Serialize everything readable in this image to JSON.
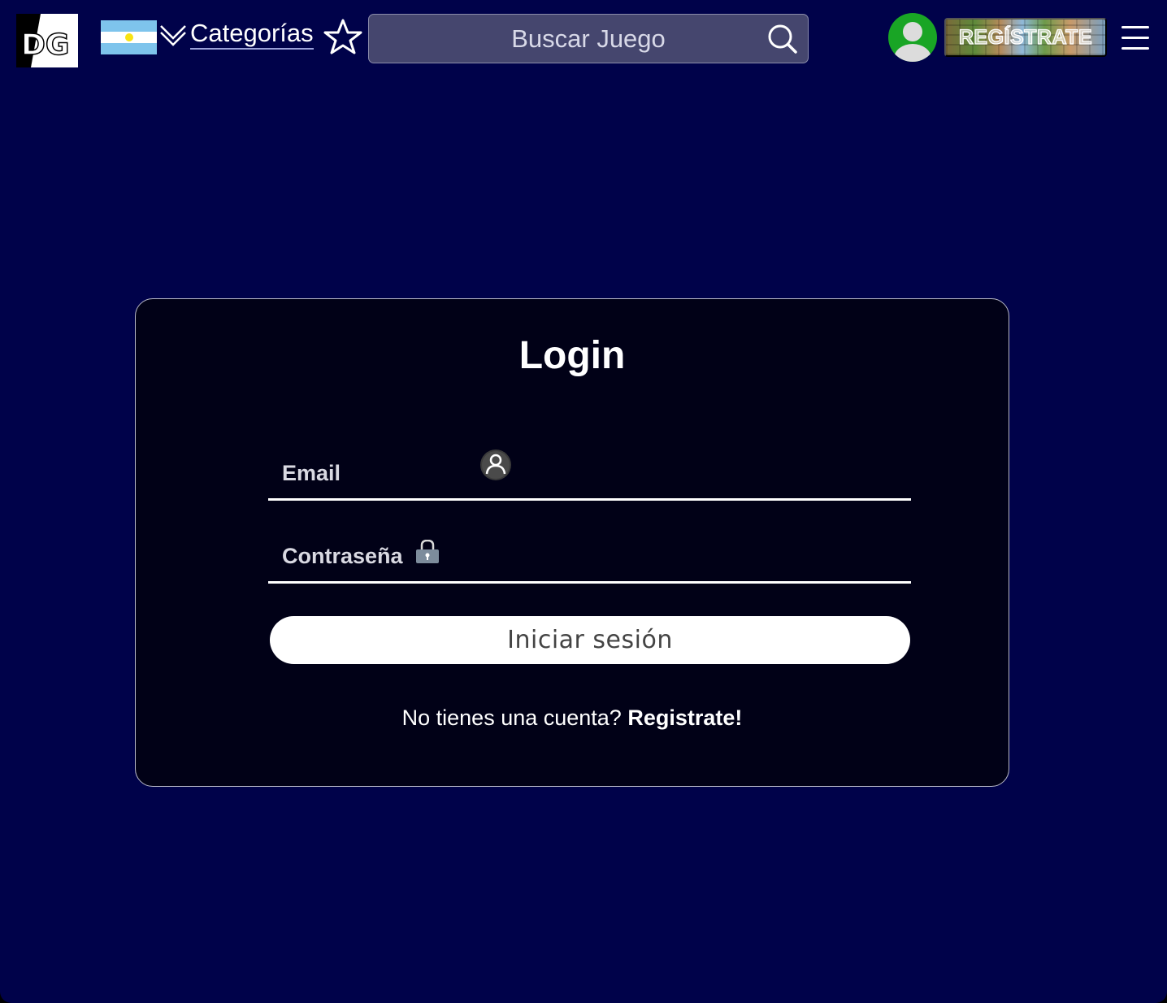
{
  "header": {
    "logo_text": "DG",
    "categories_label": "Categorías",
    "search": {
      "placeholder": "Buscar Juego"
    },
    "register_label": "REGÍSTRATE",
    "icons": {
      "flag": "argentina-flag-icon",
      "chevron": "chevron-down-icon",
      "favorites": "star-icon",
      "search": "search-icon",
      "avatar": "user-avatar-icon",
      "menu": "hamburger-menu-icon"
    }
  },
  "login": {
    "title": "Login",
    "email_label": "Email",
    "password_label": "Contraseña",
    "submit_label": "Iniciar sesión",
    "no_account_text": "No tienes una cuenta? ",
    "register_link": "Registrate!",
    "icons": {
      "email": "user-circle-icon",
      "password": "lock-icon"
    }
  },
  "colors": {
    "page_background": "#00024a",
    "card_background": "#010117",
    "search_background": "#45466e",
    "avatar_green": "#19a525"
  }
}
